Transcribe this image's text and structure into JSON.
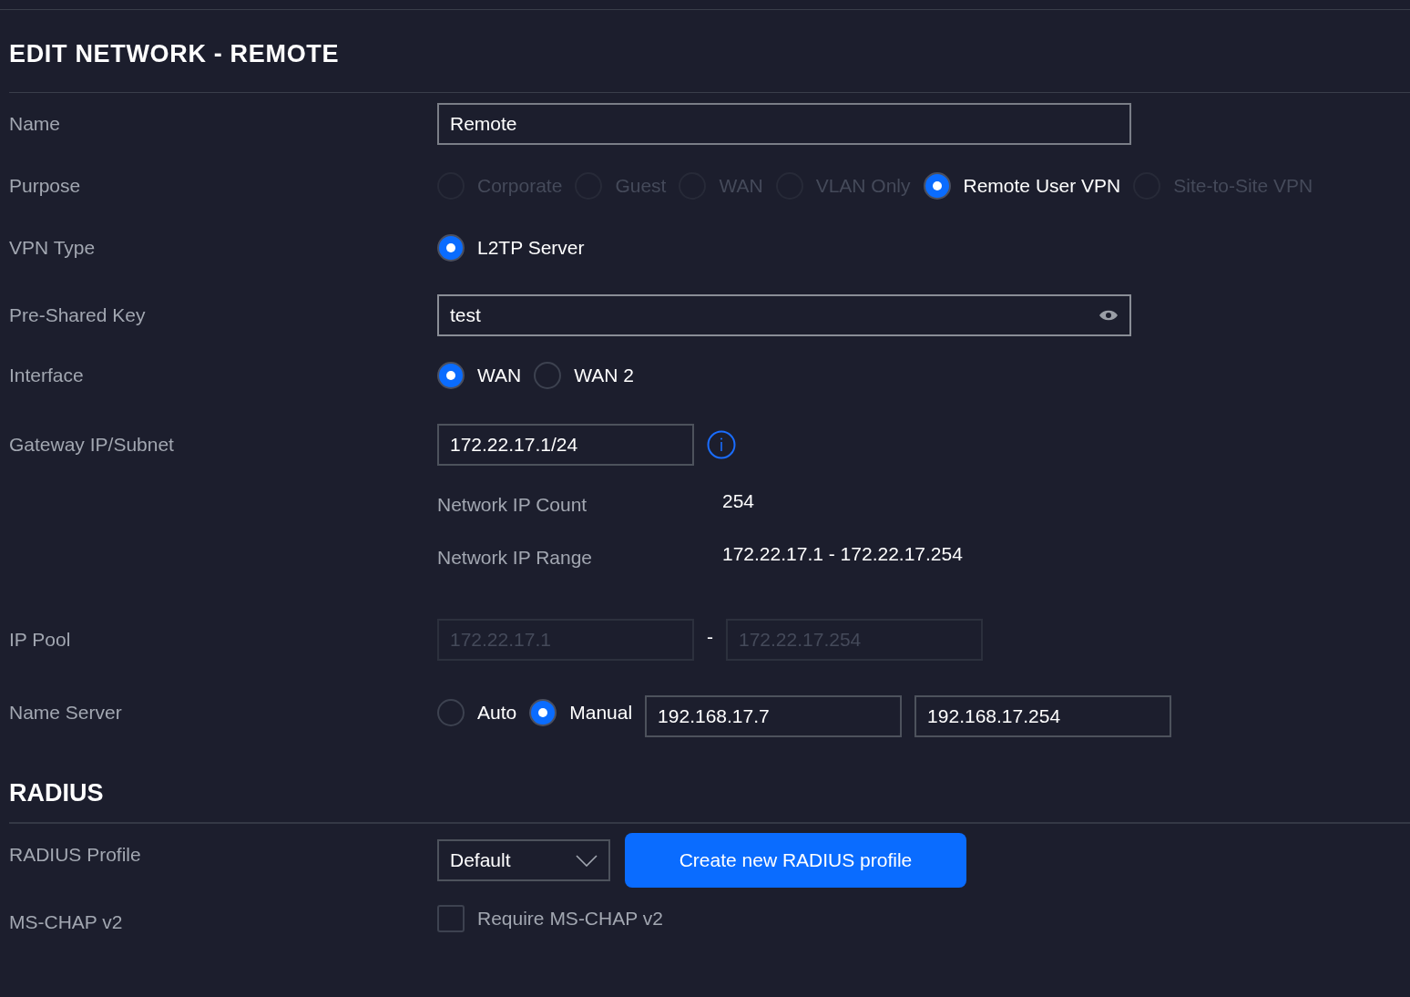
{
  "title": "EDIT NETWORK - REMOTE",
  "rows": [
    {
      "kind": "text_field",
      "label": "Name",
      "value": "Remote"
    },
    {
      "kind": "radio_group",
      "label": "Purpose",
      "options": [
        {
          "label": "Corporate",
          "selected": false,
          "disabled": true
        },
        {
          "label": "Guest",
          "selected": false,
          "disabled": true
        },
        {
          "label": "WAN",
          "selected": false,
          "disabled": true
        },
        {
          "label": "VLAN Only",
          "selected": false,
          "disabled": true
        },
        {
          "label": "Remote User VPN",
          "selected": true,
          "disabled": false
        },
        {
          "label": "Site-to-Site VPN",
          "selected": false,
          "disabled": true
        }
      ]
    },
    {
      "kind": "radio_group",
      "label": "VPN Type",
      "options": [
        {
          "label": "L2TP Server",
          "selected": true,
          "disabled": false
        }
      ]
    },
    {
      "kind": "password_field",
      "label": "Pre-Shared Key",
      "value": "test"
    },
    {
      "kind": "radio_group",
      "label": "Interface",
      "options": [
        {
          "label": "WAN",
          "selected": true,
          "disabled": false
        },
        {
          "label": "WAN 2",
          "selected": false,
          "disabled": false
        }
      ]
    },
    {
      "kind": "ip_field",
      "label": "Gateway IP/Subnet",
      "value": "172.22.17.1/24"
    },
    {
      "kind": "info",
      "label": "Network IP Count",
      "value": "254"
    },
    {
      "kind": "info",
      "label": "Network IP Range",
      "value": "172.22.17.1 - 172.22.17.254"
    },
    {
      "kind": "range",
      "label": "IP Pool",
      "start": "172.22.17.1",
      "separator": "-",
      "end": "172.22.17.254"
    },
    {
      "kind": "name_server",
      "label": "Name Server",
      "options": [
        {
          "label": "Auto",
          "selected": false,
          "disabled": false
        },
        {
          "label": "Manual",
          "selected": true,
          "disabled": false
        }
      ],
      "servers": [
        "192.168.17.7",
        "192.168.17.254"
      ]
    }
  ],
  "radius": {
    "title": "RADIUS",
    "profile_label": "RADIUS Profile",
    "profile_value": "Default",
    "create_button": "Create new RADIUS profile",
    "mschap_label": "MS-CHAP v2",
    "mschap_checkbox": "Require MS-CHAP v2",
    "mschap_checked": false
  }
}
